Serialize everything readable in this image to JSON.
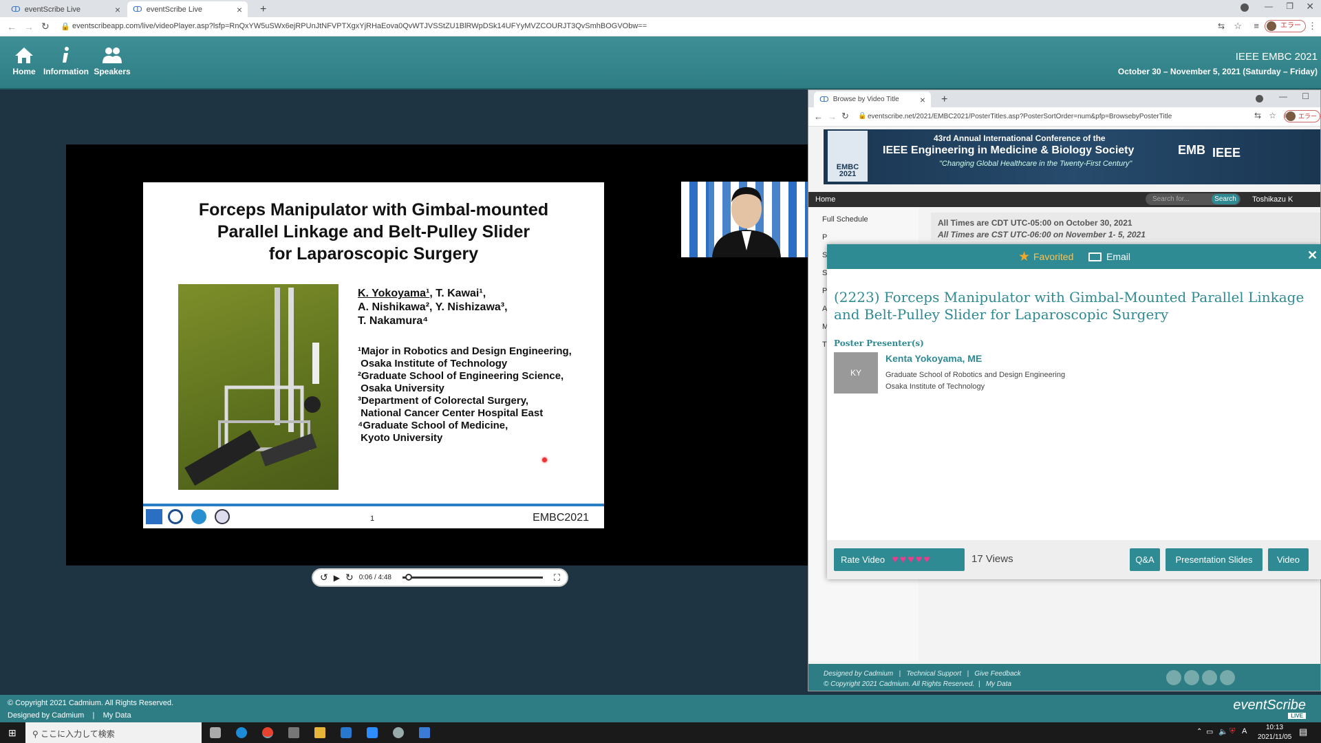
{
  "browser": {
    "tabs": [
      {
        "title": "eventScribe Live"
      },
      {
        "title": "eventScribe Live"
      }
    ],
    "url": "eventscribeapp.com/live/videoPlayer.asp?lsfp=RnQxYW5uSWx6ejRPUnJtNFVPTXgxYjRHaEova0QvWTJVSStZU1BlRWpDSk14UFYyMVZCOURJT3QvSmhBOGVObw==",
    "profile_label": "エラー"
  },
  "site_header": {
    "nav": [
      {
        "label": "Home",
        "icon": "home-icon"
      },
      {
        "label": "Information",
        "icon": "info-icon"
      },
      {
        "label": "Speakers",
        "icon": "speakers-icon"
      }
    ],
    "conf_title": "IEEE EMBC 2021",
    "conf_dates": "October 30 – November 5, 2021 (Saturday – Friday)"
  },
  "slide": {
    "title_lines": [
      "Forceps Manipulator with Gimbal-mounted",
      "Parallel Linkage and Belt-Pulley Slider",
      "for Laparoscopic Surgery"
    ],
    "author_lines": [
      "K. Yokoyama¹, T. Kawai¹,",
      "A. Nishikawa², Y. Nishizawa³,",
      "T. Nakamura⁴"
    ],
    "affiliation_lines": [
      "¹Major in Robotics and Design Engineering,",
      " Osaka Institute of Technology",
      "²Graduate School of Engineering Science,",
      " Osaka University",
      "³Department of Colorectal Surgery,",
      " National Cancer Center Hospital East",
      "⁴Graduate School of Medicine,",
      " Kyoto University"
    ],
    "page_number": "1",
    "footer_tag": "EMBC2021"
  },
  "player": {
    "time": "0:06 / 4:48",
    "progress_fraction": 0.021
  },
  "page_footer": {
    "copyright": "© Copyright 2021 Cadmium. All Rights Reserved.",
    "designed_by": "Designed by Cadmium",
    "my_data": "My Data",
    "brand": "eventScribe",
    "brand_sub": "LIVE"
  },
  "taskbar": {
    "search_placeholder": "ここに入力して検索",
    "time": "10:13",
    "date": "2021/11/05",
    "ime": "A"
  },
  "window2": {
    "tab_title": "Browse by Video Title",
    "url": "eventscribe.net/2021/EMBC2021/PosterTitles.asp?PosterSortOrder=num&pfp=BrowsebyPosterTitle",
    "profile_label": "エラー",
    "banner": {
      "logo_text": "EMBC 2021",
      "line1": "43rd Annual International Conference of the",
      "line2": "IEEE Engineering in Medicine & Biology Society",
      "tagline": "\"Changing Global Healthcare in the Twenty-First Century\"",
      "emb": "EMB",
      "ieee": "IEEE"
    },
    "nav": {
      "home": "Home",
      "search_placeholder": "Search for...",
      "search_button": "Search",
      "user": "Toshikazu K"
    },
    "sidebar_first": "Full Schedule",
    "sidebar_partial": [
      "P",
      "S",
      "S",
      "P",
      "A",
      "M",
      "T"
    ],
    "times_note_1": "All Times are CDT UTC-05:00 on October 30, 2021",
    "times_note_2": "All Times are CST UTC-06:00 on November 1- 5, 2021",
    "footer": {
      "designed_by": "Designed by Cadmium",
      "tech_support": "Technical Support",
      "feedback": "Give Feedback",
      "copyright": "© Copyright 2021 Cadmium. All Rights Reserved.",
      "my_data": "My Data"
    }
  },
  "modal": {
    "favorited": "Favorited",
    "email": "Email",
    "title": "(2223) Forceps Manipulator with Gimbal-Mounted Parallel Linkage and Belt-Pulley Slider for Laparoscopic Surgery",
    "presenters_label": "Poster Presenter(s)",
    "presenter": {
      "initials": "KY",
      "name": "Kenta Yokoyama, ME",
      "affiliation_1": "Graduate School of Robotics and Design Engineering",
      "affiliation_2": "Osaka Institute of Technology"
    },
    "rate_label": "Rate Video",
    "rating": 5,
    "views": "17 Views",
    "buttons": {
      "qa": "Q&A",
      "slides": "Presentation Slides",
      "video": "Video"
    }
  },
  "colors": {
    "accent": "#2e8a93",
    "heart": "#e83e8c",
    "star": "#f5a623"
  }
}
